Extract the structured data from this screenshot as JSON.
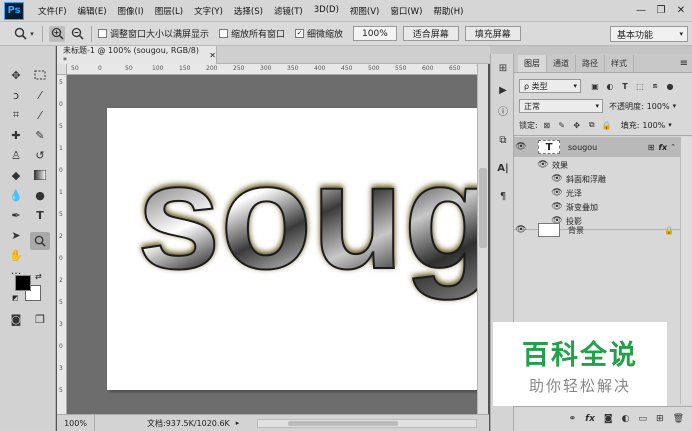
{
  "app": {
    "logo": "Ps"
  },
  "menu": [
    "文件(F)",
    "编辑(E)",
    "图像(I)",
    "图层(L)",
    "文字(Y)",
    "选择(S)",
    "滤镜(T)",
    "3D(D)",
    "视图(V)",
    "窗口(W)",
    "帮助(H)"
  ],
  "window_controls": {
    "minimize": "—",
    "restore": "❐",
    "close": "✕"
  },
  "options": {
    "resize_windows_label": "调整窗口大小以满屏显示",
    "zoom_all_label": "缩放所有窗口",
    "scrubby_zoom_label": "细微缩放",
    "scrubby_checked": true,
    "zoom_value": "100%",
    "fit_screen_label": "适合屏幕",
    "fill_screen_label": "填充屏幕",
    "workspace": "基本功能"
  },
  "document": {
    "tab_title": "未标题-1 @ 100% (sougou, RGB/8) *",
    "text": "soug",
    "ruler_top_ticks": [
      "50",
      "0",
      "50",
      "100",
      "150",
      "200",
      "250",
      "300",
      "350",
      "400",
      "450",
      "500",
      "550",
      "600",
      "650",
      "700"
    ],
    "ruler_left_ticks": [
      "5",
      "0",
      "5",
      "1",
      "0",
      "1",
      "5",
      "2",
      "0",
      "2",
      "5",
      "3",
      "0",
      "3",
      "5"
    ]
  },
  "status": {
    "zoom": "100%",
    "doc_size": "文档:937.5K/1020.6K"
  },
  "layers_panel": {
    "tabs": [
      "图层",
      "通道",
      "路径",
      "样式"
    ],
    "filter_kind": "ρ 类型",
    "blend_mode": "正常",
    "opacity_label": "不透明度:",
    "opacity_value": "100%",
    "lock_label": "锁定:",
    "fill_label": "填充:",
    "fill_value": "100%",
    "layers": [
      {
        "name": "sougou",
        "type": "text",
        "thumb": "T",
        "fx": "fx"
      },
      {
        "name": "效果",
        "type": "effects-header"
      },
      {
        "name": "斜面和浮雕",
        "type": "effect"
      },
      {
        "name": "光泽",
        "type": "effect"
      },
      {
        "name": "渐变叠加",
        "type": "effect"
      },
      {
        "name": "投影",
        "type": "effect"
      },
      {
        "name": "背景",
        "type": "background"
      }
    ]
  },
  "watermark": {
    "title": "百科全说",
    "subtitle": "助你轻松解决"
  }
}
